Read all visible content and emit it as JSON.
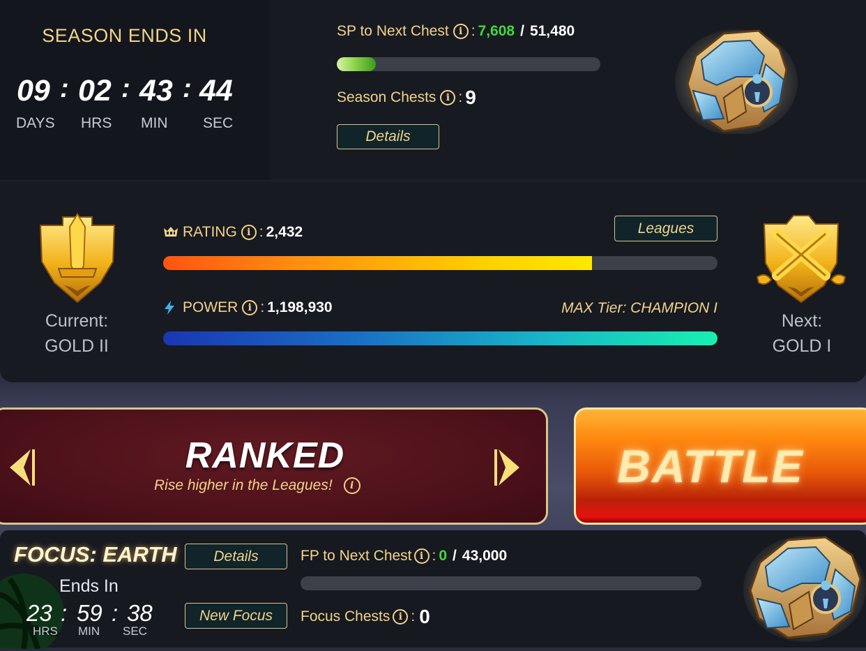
{
  "season": {
    "title": "SEASON ENDS IN",
    "countdown": {
      "days": "09",
      "hrs": "02",
      "min": "43",
      "sec": "44",
      "separator": ":"
    },
    "units": {
      "days": "DAYS",
      "hrs": "HRS",
      "min": "MIN",
      "sec": "SEC"
    },
    "sp_label": "SP to Next Chest",
    "sp_current": "7,608",
    "sp_slash": "/",
    "sp_target": "51,480",
    "sp_progress_fraction": 0.148,
    "chests_label": "Season Chests",
    "chests_count": "9",
    "details_button": "Details",
    "chest_icon": "season-chest-icon"
  },
  "league": {
    "current_label": "Current:",
    "current_rank": "GOLD II",
    "next_label": "Next:",
    "next_rank": "GOLD I",
    "rating_label": "RATING",
    "rating_value": "2,432",
    "rating_progress_fraction": 0.774,
    "power_label": "POWER",
    "power_value": "1,198,930",
    "power_progress_fraction": 1.0,
    "max_tier": "MAX Tier: CHAMPION I",
    "leagues_button": "Leagues",
    "colon": ":"
  },
  "mode": {
    "title": "RANKED",
    "subtitle": "Rise higher in the Leagues!",
    "battle_label": "BATTLE"
  },
  "focus": {
    "title": "FOCUS: EARTH",
    "details_button": "Details",
    "new_focus_button": "New Focus",
    "ends_in": "Ends In",
    "countdown": {
      "hrs": "23",
      "min": "59",
      "sec": "38",
      "separator": ":"
    },
    "units": {
      "hrs": "HRS",
      "min": "MIN",
      "sec": "SEC"
    },
    "fp_label": "FP to Next Chest",
    "fp_current": "0",
    "fp_slash": "/",
    "fp_target": "43,000",
    "fp_progress_fraction": 0.0,
    "chests_label": "Focus Chests",
    "chests_count": "0"
  },
  "colors": {
    "gold_text": "#f2d48a",
    "green_value": "#3fd93a",
    "battle_orange": "#ff8a10",
    "ranked_red": "#4a1019"
  }
}
